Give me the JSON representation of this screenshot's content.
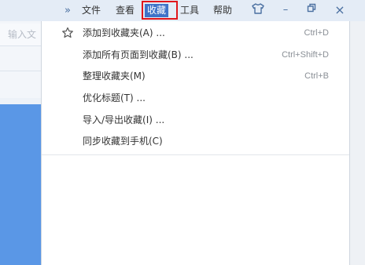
{
  "menubar": {
    "chevron": "»",
    "items": [
      "文件",
      "查看",
      "收藏",
      "工具",
      "帮助"
    ],
    "active_index": 2,
    "window_buttons": {
      "skin": "shirt-icon",
      "minimize": "–",
      "restore": "restore-icon",
      "close": "×"
    }
  },
  "search": {
    "placeholder": "输入文"
  },
  "favorites_menu": {
    "items": [
      {
        "label": "添加到收藏夹(A) ...",
        "shortcut": "Ctrl+D",
        "icon": "star-outline-icon"
      },
      {
        "label": "添加所有页面到收藏(B) ...",
        "shortcut": "Ctrl+Shift+D"
      },
      {
        "label": "整理收藏夹(M)",
        "shortcut": "Ctrl+B"
      },
      {
        "label": "优化标题(T) ...",
        "shortcut": ""
      },
      {
        "label": "导入/导出收藏(I) ...",
        "shortcut": ""
      },
      {
        "label": "同步收藏到手机(C)",
        "shortcut": ""
      }
    ]
  },
  "colors": {
    "menubar_bg": "#e4ecf6",
    "active_menu_bg": "#3f73c8",
    "highlight_border": "#e0161b",
    "page_blue": "#5a97e6"
  }
}
